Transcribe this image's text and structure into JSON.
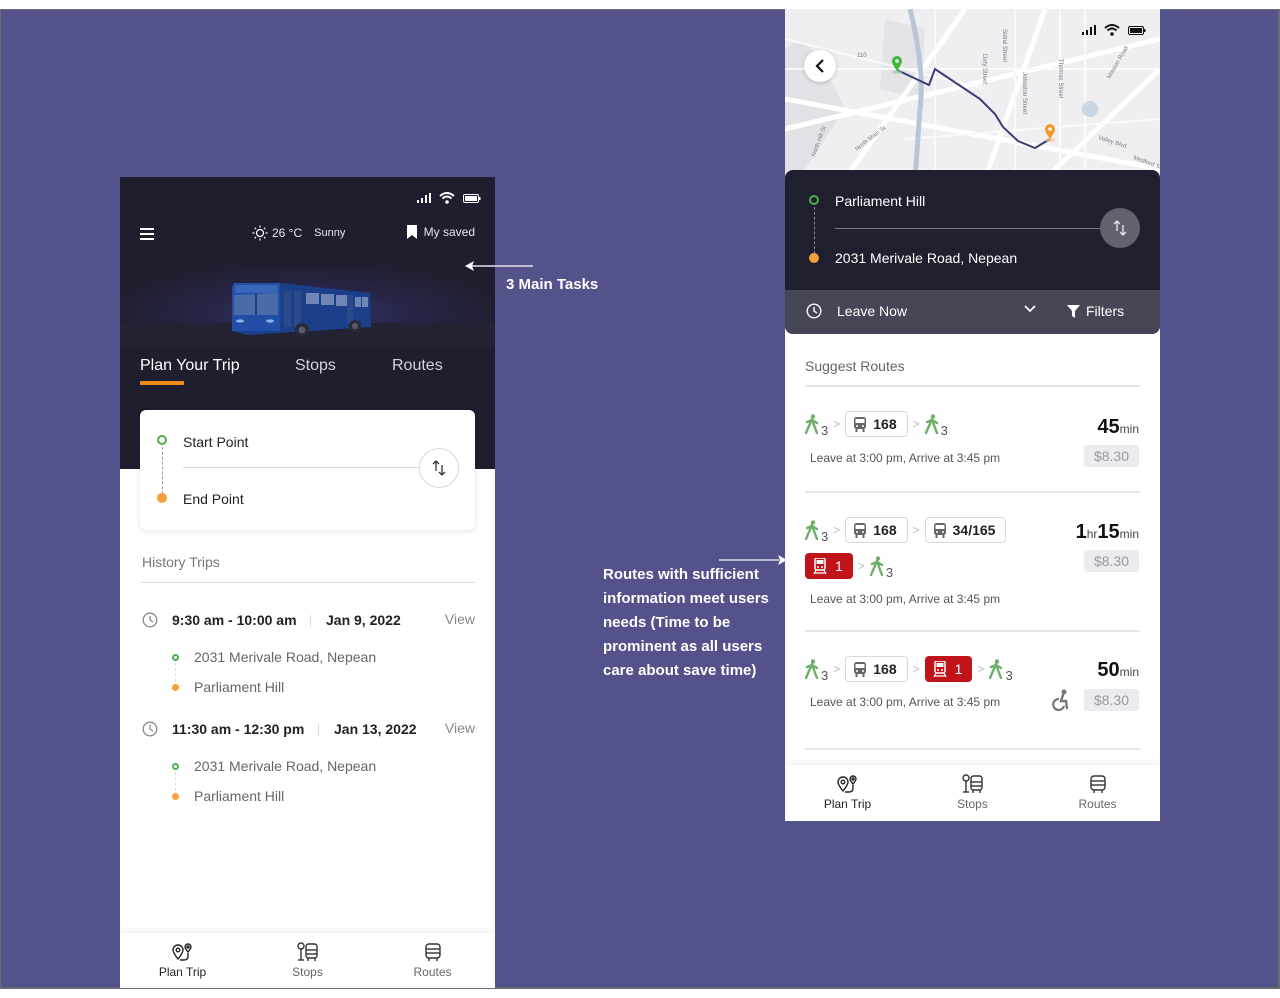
{
  "annotations": {
    "main_tasks": "3 Main Tasks",
    "routes_note": "Routes with sufficient information meet users needs (Time to be prominent as all users care about save time)"
  },
  "colors": {
    "canvas_bg": "#53528a",
    "dark_header": "#1f1e2e",
    "accent_orange": "#f08c1c",
    "start_green": "#4caf50",
    "end_orange": "#f7a03a",
    "train_red": "#c0141a",
    "walk_green": "#6db06a"
  },
  "left_screen": {
    "status_icons": [
      "signal-icon",
      "wifi-icon",
      "battery-icon"
    ],
    "header": {
      "menu_icon": "hamburger-icon",
      "weather_icon": "sun-icon",
      "temperature": "26 °C",
      "condition": "Sunny",
      "saved_icon": "bookmark-icon",
      "saved_label": "My saved"
    },
    "tabs": [
      {
        "label": "Plan Your Trip",
        "active": true
      },
      {
        "label": "Stops",
        "active": false
      },
      {
        "label": "Routes",
        "active": false
      }
    ],
    "trip_form": {
      "start_placeholder": "Start Point",
      "end_placeholder": "End Point",
      "swap_icon": "swap-vertical-icon"
    },
    "history": {
      "title": "History Trips",
      "trips": [
        {
          "time": "9:30 am - 10:00 am",
          "date": "Jan 9, 2022",
          "action": "View",
          "from": "2031 Merivale Road, Nepean",
          "to": "Parliament Hill"
        },
        {
          "time": "11:30 am - 12:30 pm",
          "date": "Jan 13, 2022",
          "action": "View",
          "from": "2031 Merivale Road, Nepean",
          "to": "Parliament Hill"
        }
      ]
    },
    "bottom_nav": [
      {
        "label": "Plan Trip",
        "icon": "plan-trip-icon",
        "active": true
      },
      {
        "label": "Stops",
        "icon": "bus-stop-icon",
        "active": false
      },
      {
        "label": "Routes",
        "icon": "bus-icon",
        "active": false
      }
    ]
  },
  "right_screen": {
    "map": {
      "labels": [
        "110",
        "Sidral Street",
        "Dirty Street",
        "Johnston Street",
        "Thomas Street",
        "Mission Road",
        "North Hill St",
        "North Main St",
        "Valley Blvd",
        "Medford St"
      ]
    },
    "search": {
      "from": "Parliament Hill",
      "to": "2031 Merivale Road, Nepean",
      "time_option": "Leave Now",
      "filters_label": "Filters"
    },
    "suggest_title": "Suggest Routes",
    "routes": [
      {
        "legs_row1": [
          {
            "type": "walk",
            "value": "3"
          },
          {
            "type": "bus",
            "value": "168"
          },
          {
            "type": "walk",
            "value": "3"
          }
        ],
        "legs_row2": [],
        "duration_main": "45",
        "duration_unit": "min",
        "duration_hr": "",
        "schedule": "Leave at 3:00 pm, Arrive at 3:45 pm",
        "price": "$8.30",
        "wheelchair": false
      },
      {
        "legs_row1": [
          {
            "type": "walk",
            "value": "3"
          },
          {
            "type": "bus",
            "value": "168"
          },
          {
            "type": "bus",
            "value": "34/165"
          }
        ],
        "legs_row2": [
          {
            "type": "train",
            "value": "1"
          },
          {
            "type": "walk",
            "value": "3"
          }
        ],
        "duration_hr": "1",
        "duration_hr_unit": "hr",
        "duration_main": "15",
        "duration_unit": "min",
        "schedule": "Leave at 3:00 pm, Arrive at 3:45 pm",
        "price": "$8.30",
        "wheelchair": false
      },
      {
        "legs_row1": [
          {
            "type": "walk",
            "value": "3"
          },
          {
            "type": "bus",
            "value": "168"
          },
          {
            "type": "train",
            "value": "1"
          },
          {
            "type": "walk",
            "value": "3"
          }
        ],
        "legs_row2": [],
        "duration_main": "50",
        "duration_unit": "min",
        "duration_hr": "",
        "schedule": "Leave at 3:00 pm, Arrive at 3:45 pm",
        "price": "$8.30",
        "wheelchair": true
      }
    ],
    "bottom_nav": [
      {
        "label": "Plan Trip",
        "icon": "plan-trip-icon",
        "active": true
      },
      {
        "label": "Stops",
        "icon": "bus-stop-icon",
        "active": false
      },
      {
        "label": "Routes",
        "icon": "bus-icon",
        "active": false
      }
    ]
  }
}
